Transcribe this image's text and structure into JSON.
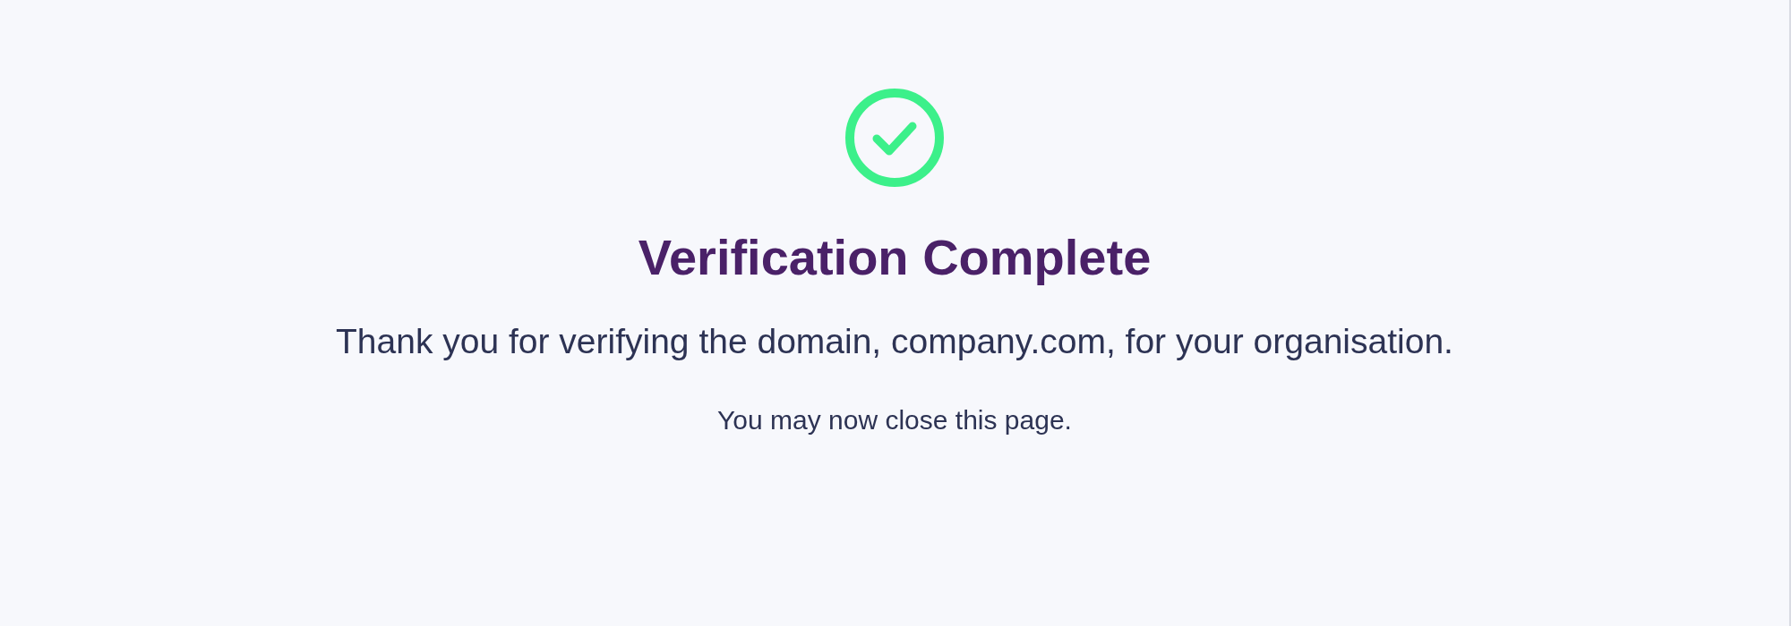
{
  "verified": true,
  "title": "Verification Complete",
  "message": "Thank you for verifying the domain, company.com, for your organisation.",
  "note": "You may now close this page."
}
